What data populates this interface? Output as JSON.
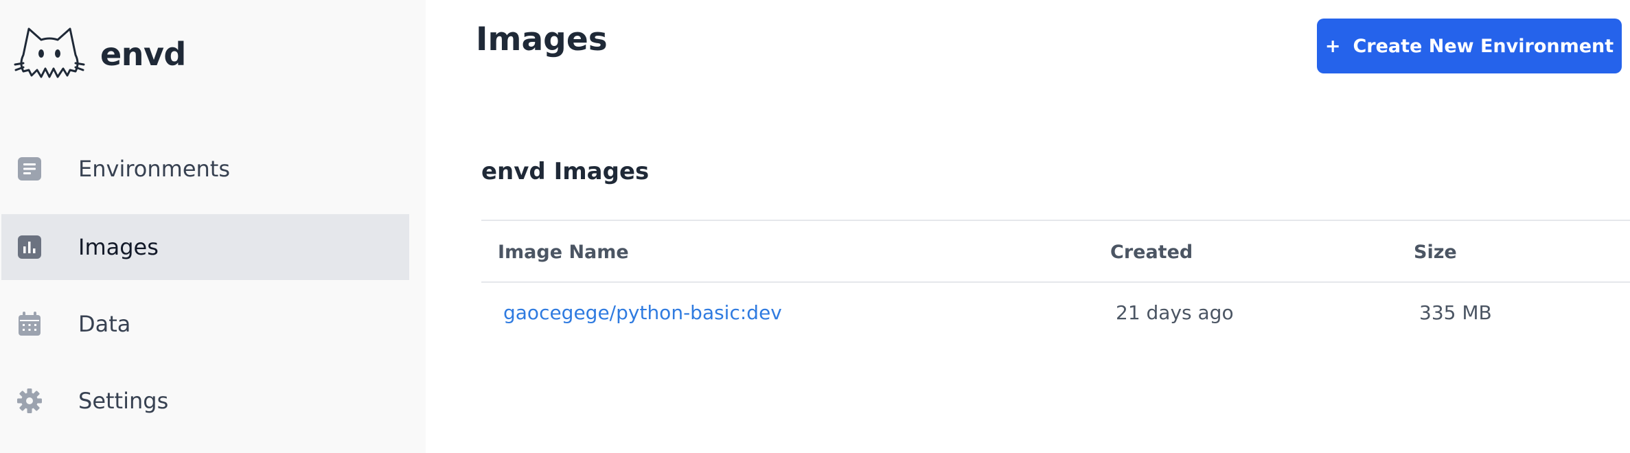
{
  "brand": {
    "name": "envd",
    "logo_icon": "cat-logo-icon"
  },
  "sidebar": {
    "items": [
      {
        "label": "Environments",
        "icon": "document-icon",
        "active": false
      },
      {
        "label": "Images",
        "icon": "chart-bar-icon",
        "active": true
      },
      {
        "label": "Data",
        "icon": "calendar-icon",
        "active": false
      },
      {
        "label": "Settings",
        "icon": "gear-icon",
        "active": false
      }
    ]
  },
  "header": {
    "title": "Images",
    "create_button": {
      "icon": "+",
      "label": "Create New Environment"
    }
  },
  "section": {
    "title": "envd Images"
  },
  "table": {
    "columns": [
      "Image Name",
      "Created",
      "Size"
    ],
    "rows": [
      {
        "name": "gaocegege/python-basic:dev",
        "created": "21 days ago",
        "size": "335 MB"
      }
    ]
  },
  "colors": {
    "accent": "#2563eb",
    "link": "#2f7be0",
    "sidebar_bg": "#f9f9f9",
    "active_bg": "#e5e7eb",
    "icon_gray": "#9ca3af"
  }
}
